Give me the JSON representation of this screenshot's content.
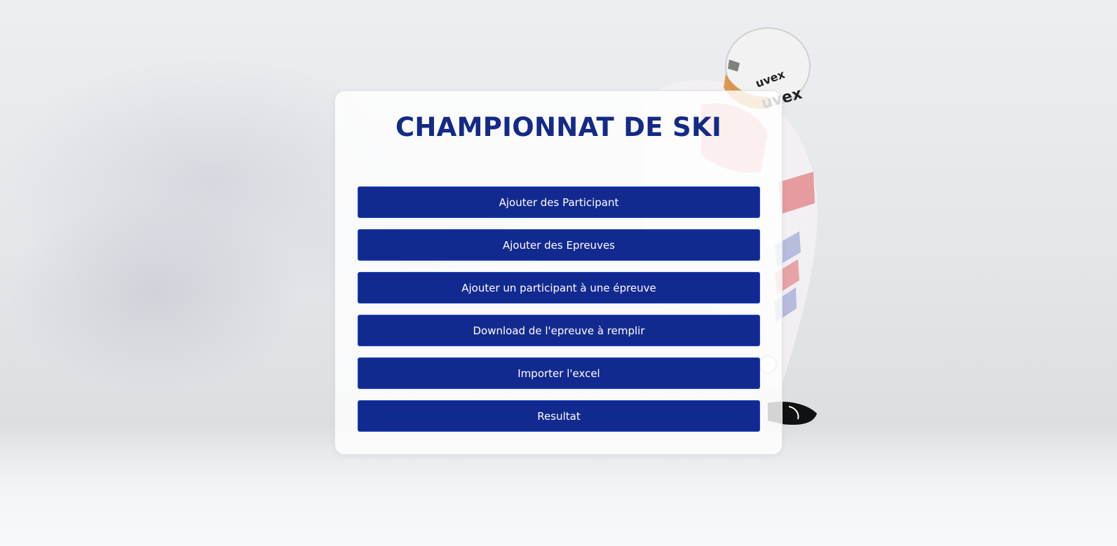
{
  "page": {
    "title": "CHAMPIONNAT DE SKI"
  },
  "menu": {
    "buttons": [
      {
        "label": "Ajouter des Participant"
      },
      {
        "label": "Ajouter des Epreuves"
      },
      {
        "label": "Ajouter un participant à une épreuve"
      },
      {
        "label": "Download de l'epreuve à remplir"
      },
      {
        "label": "Importer l'excel"
      },
      {
        "label": "Resultat"
      }
    ]
  },
  "colors": {
    "primary": "#122a8f",
    "title": "#142a86",
    "button_border": "#1f49c9"
  }
}
